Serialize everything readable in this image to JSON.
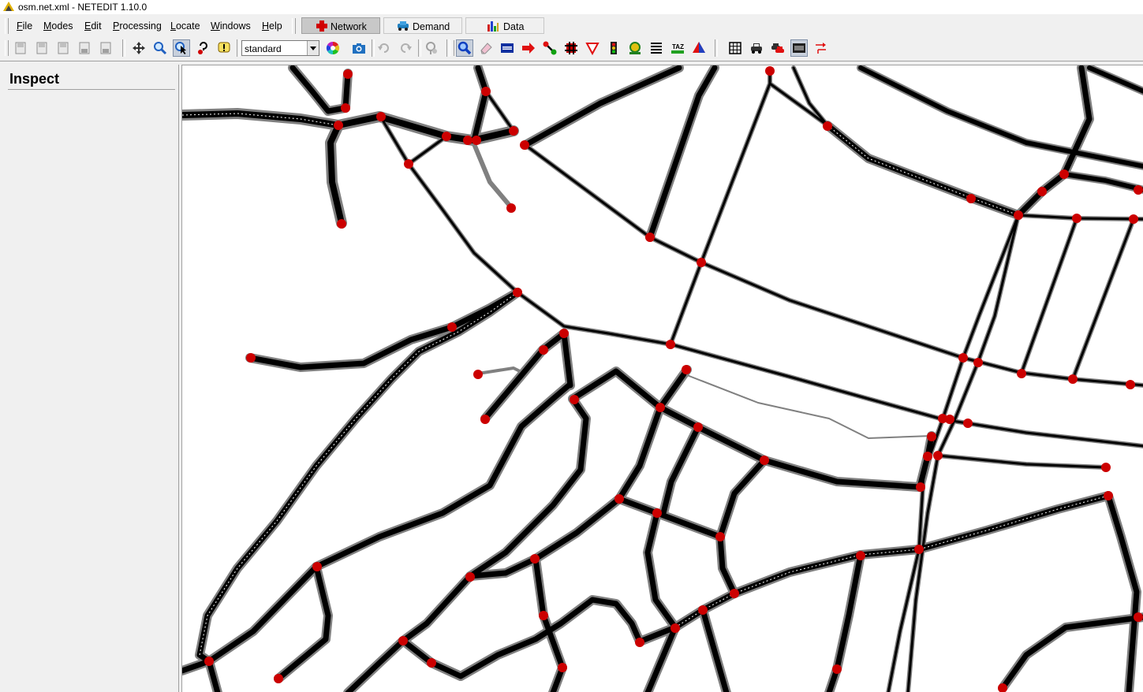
{
  "window": {
    "title": "osm.net.xml - NETEDIT 1.10.0"
  },
  "menu": {
    "items": [
      {
        "name": "menu-file",
        "label": "File"
      },
      {
        "name": "menu-modes",
        "label": "Modes"
      },
      {
        "name": "menu-edit",
        "label": "Edit"
      },
      {
        "name": "menu-processing",
        "label": "Processing"
      },
      {
        "name": "menu-locate",
        "label": "Locate"
      },
      {
        "name": "menu-windows",
        "label": "Windows"
      },
      {
        "name": "menu-help",
        "label": "Help"
      }
    ]
  },
  "supermodes": {
    "network": "Network",
    "demand": "Demand",
    "data": "Data",
    "active": "network"
  },
  "toolbar": {
    "scheme_value": "standard",
    "icons": [
      "new-network-icon",
      "open-icon",
      "reload-icon",
      "save-icon",
      "save-as-icon",
      "recenter-icon",
      "zoom-locate-icon",
      "select-pointer-icon",
      "help-query-icon",
      "additional-info-icon",
      "color-wheel-icon",
      "screenshot-icon",
      "undo-icon",
      "redo-icon",
      "location-icon",
      "inspect-icon",
      "delete-icon",
      "select-icon",
      "move-icon",
      "create-edge-icon",
      "connection-icon",
      "prohibition-icon",
      "crossing-icon",
      "traffic-light-icon",
      "additional-icon",
      "wire-icon",
      "taz-icon",
      "polygon-icon",
      "grid-icon",
      "vehicle-icon",
      "vehicle-red-icon",
      "lane-icon",
      "arrow-icon"
    ],
    "active_tool": "inspect-icon"
  },
  "side_panel": {
    "heading": "Inspect"
  },
  "colors": {
    "junction": "#cc0000",
    "road_outline": "#808080",
    "road": "#000000",
    "active_tab": "#c8c8c8"
  }
}
